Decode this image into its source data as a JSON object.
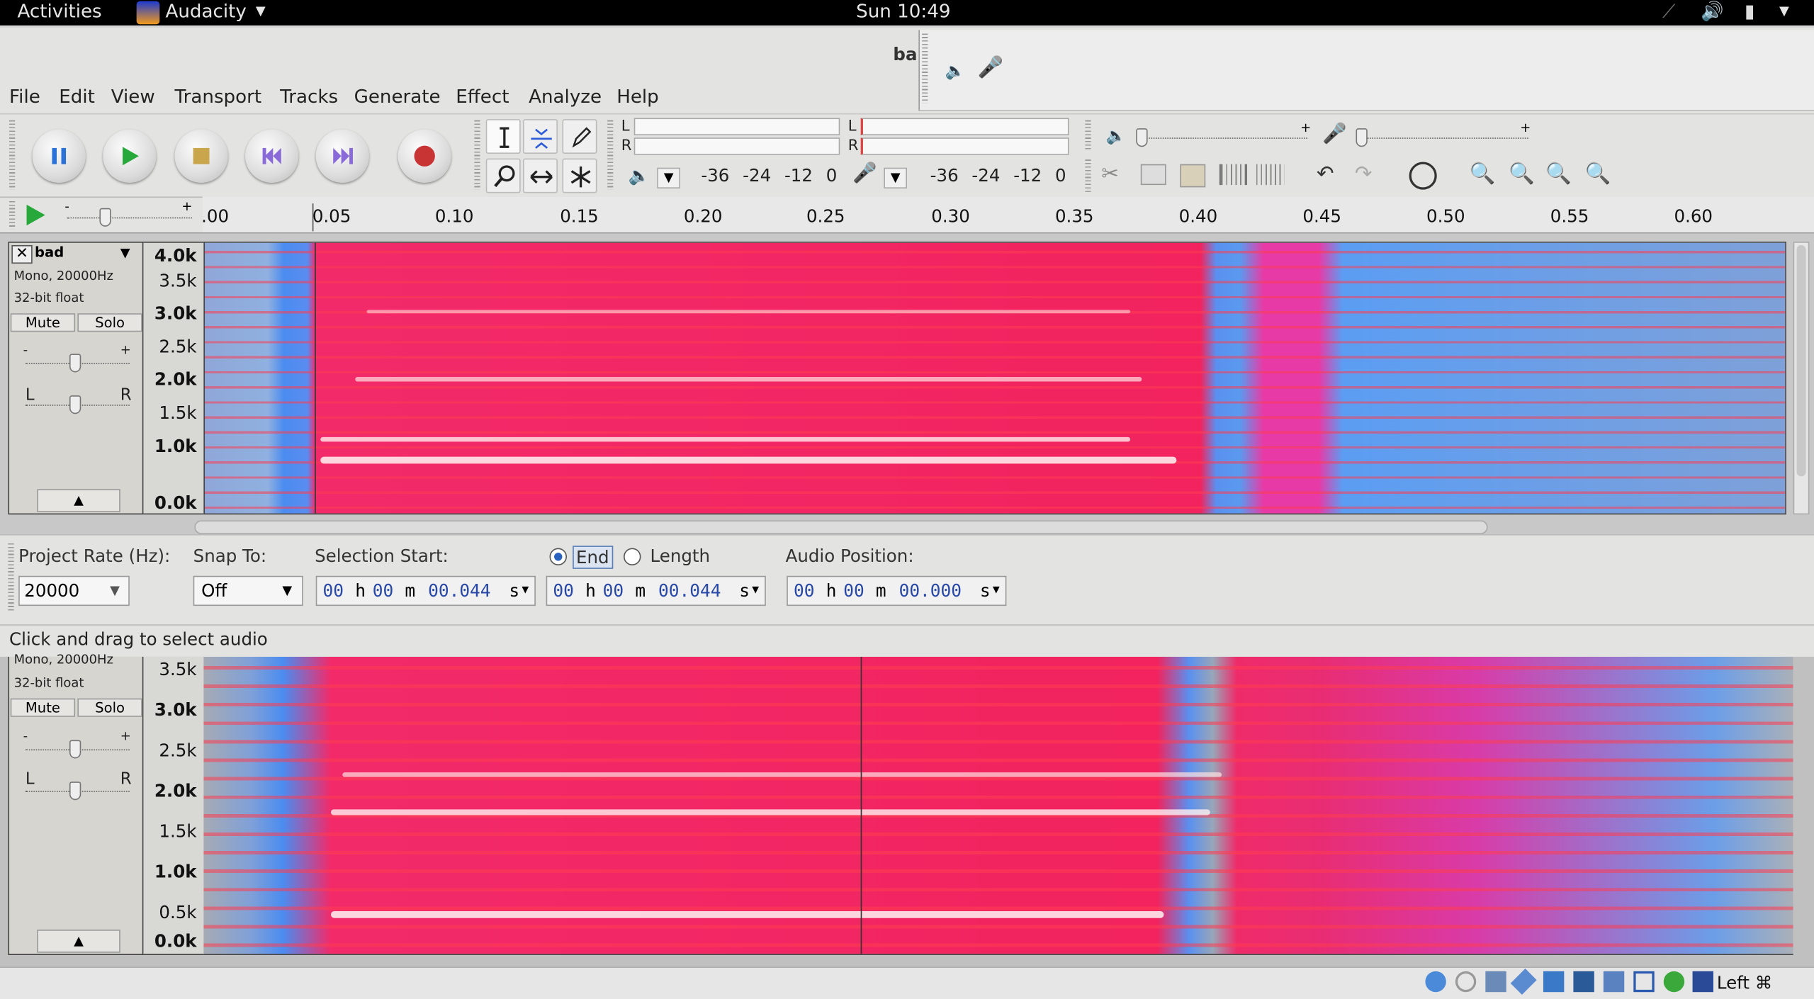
{
  "topbar": {
    "activities": "Activities",
    "app": "Audacity",
    "clock": "Sun 10:49"
  },
  "window": {
    "title_fragment": "bad"
  },
  "menu": [
    "File",
    "Edit",
    "View",
    "Transport",
    "Tracks",
    "Generate",
    "Effect",
    "Analyze",
    "Help"
  ],
  "meter": {
    "left_label": "L",
    "right_label": "R",
    "ticks": [
      "-36",
      "-24",
      "-12",
      "0"
    ]
  },
  "ruler": {
    "labels": [
      ".00",
      "0.05",
      "0.10",
      "0.15",
      "0.20",
      "0.25",
      "0.30",
      "0.35",
      "0.40",
      "0.45",
      "0.50",
      "0.55",
      "0.60"
    ]
  },
  "tracks": [
    {
      "name": "bad",
      "format": "Mono, 20000Hz",
      "bits": "32-bit float",
      "mute": "Mute",
      "solo": "Solo",
      "gain_minus": "-",
      "gain_plus": "+",
      "pan_l": "L",
      "pan_r": "R",
      "freq_labels": [
        "4.0k",
        "3.5k",
        "3.0k",
        "2.5k",
        "2.0k",
        "1.5k",
        "1.0k",
        "0.0k"
      ]
    },
    {
      "format": "Mono, 20000Hz",
      "bits": "32-bit float",
      "mute": "Mute",
      "solo": "Solo",
      "gain_minus": "-",
      "gain_plus": "+",
      "pan_l": "L",
      "pan_r": "R",
      "freq_labels": [
        "3.5k",
        "3.0k",
        "2.5k",
        "2.0k",
        "1.5k",
        "1.0k",
        "0.5k",
        "0.0k"
      ]
    }
  ],
  "selection": {
    "project_rate_label": "Project Rate (Hz):",
    "project_rate": "20000",
    "snap_label": "Snap To:",
    "snap_value": "Off",
    "sel_start_label": "Selection Start:",
    "end_label": "End",
    "length_label": "Length",
    "audio_pos_label": "Audio Position:",
    "sel_start": {
      "h": "00",
      "m": "00",
      "s": "00.044"
    },
    "end": {
      "h": "00",
      "m": "00",
      "s": "00.044"
    },
    "audio_pos": {
      "h": "00",
      "m": "00",
      "s": "00.000"
    },
    "units": {
      "h": "h",
      "m": "m",
      "s": "s"
    }
  },
  "status": "Click and drag to select audio",
  "bottom": {
    "host_key": "Left ⌘"
  }
}
